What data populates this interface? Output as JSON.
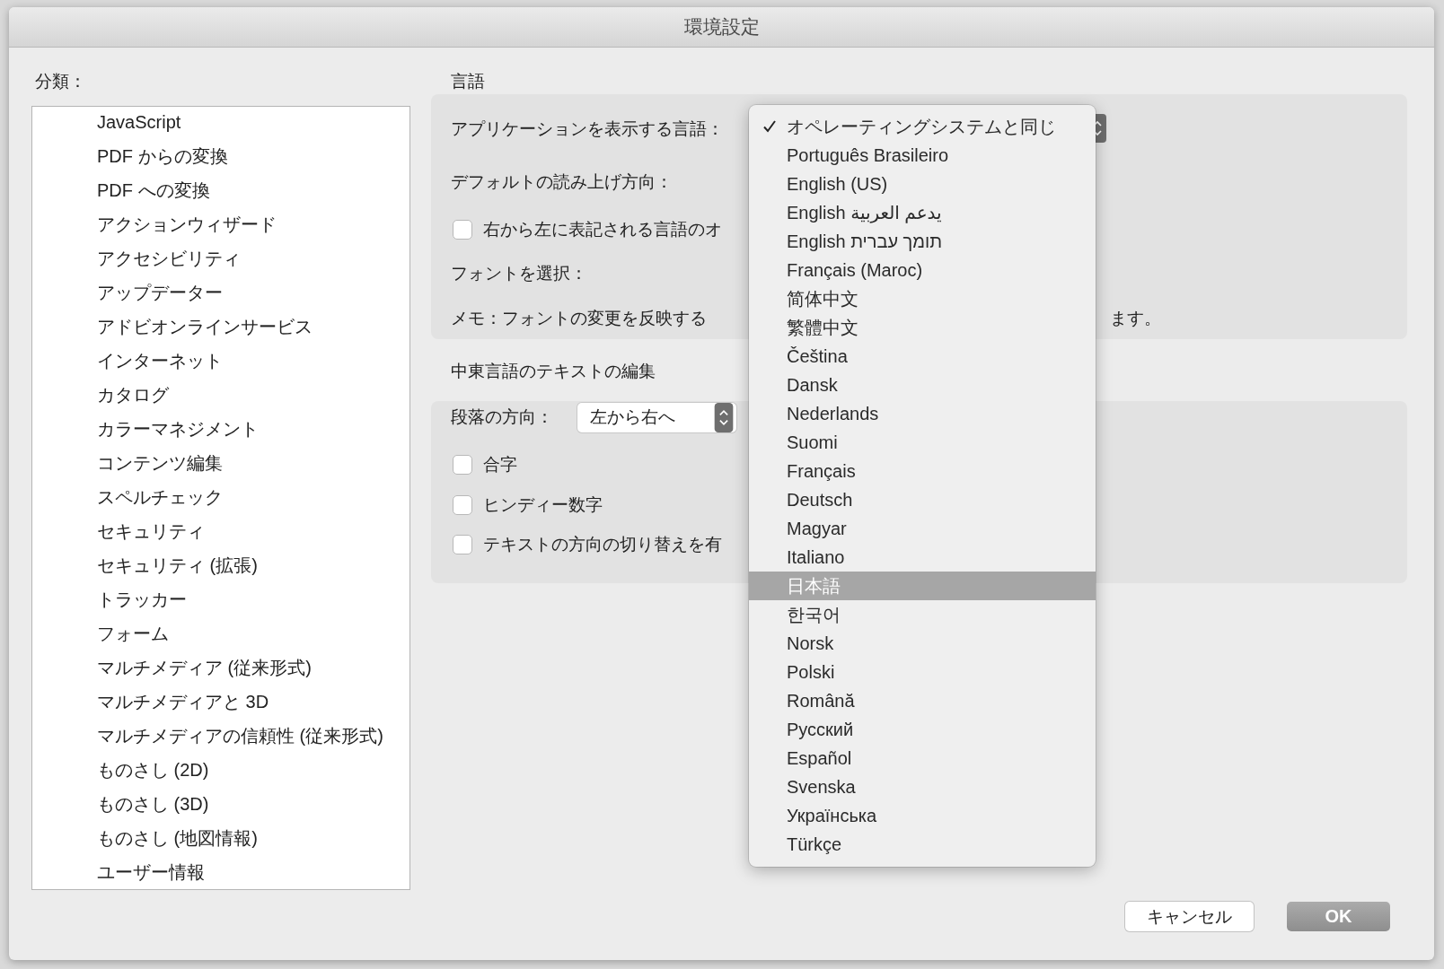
{
  "window": {
    "title": "環境設定"
  },
  "categories": {
    "label": "分類：",
    "items": [
      "JavaScript",
      "PDF からの変換",
      "PDF への変換",
      "アクションウィザード",
      "アクセシビリティ",
      "アップデーター",
      "アドビオンラインサービス",
      "インターネット",
      "カタログ",
      "カラーマネジメント",
      "コンテンツ編集",
      "スペルチェック",
      "セキュリティ",
      "セキュリティ (拡張)",
      "トラッカー",
      "フォーム",
      "マルチメディア (従来形式)",
      "マルチメディアと 3D",
      "マルチメディアの信頼性 (従来形式)",
      "ものさし (2D)",
      "ものさし (3D)",
      "ものさし (地図情報)",
      "ユーザー情報"
    ]
  },
  "language_section": {
    "title": "言語",
    "app_language": {
      "label": "アプリケーションを表示する言語："
    },
    "reading_direction": {
      "label": "デフォルトの読み上げ方向："
    },
    "rtl_option": {
      "label": "右から左に表記される言語のオ",
      "checked": false
    },
    "font": {
      "label": "フォントを選択："
    },
    "note": {
      "left": "メモ：フォントの変更を反映する",
      "right": "ます。"
    }
  },
  "middle_east_section": {
    "title": "中東言語のテキストの編集",
    "paragraph_direction": {
      "label": "段落の方向：",
      "value": "左から右へ"
    },
    "options": [
      {
        "label": "合字",
        "checked": false
      },
      {
        "label": "ヒンディー数字",
        "checked": false
      },
      {
        "label": "テキストの方向の切り替えを有",
        "checked": false
      }
    ]
  },
  "language_menu": {
    "items": [
      {
        "label": "オペレーティングシステムと同じ",
        "checked": true,
        "selected": false
      },
      {
        "label": "Português Brasileiro",
        "checked": false,
        "selected": false
      },
      {
        "label": "English (US)",
        "checked": false,
        "selected": false
      },
      {
        "label": "English يدعم العربية",
        "checked": false,
        "selected": false
      },
      {
        "label": "English תומך עברית",
        "checked": false,
        "selected": false
      },
      {
        "label": "Français (Maroc)",
        "checked": false,
        "selected": false
      },
      {
        "label": "简体中文",
        "checked": false,
        "selected": false
      },
      {
        "label": "繁體中文",
        "checked": false,
        "selected": false
      },
      {
        "label": "Čeština",
        "checked": false,
        "selected": false
      },
      {
        "label": "Dansk",
        "checked": false,
        "selected": false
      },
      {
        "label": "Nederlands",
        "checked": false,
        "selected": false
      },
      {
        "label": "Suomi",
        "checked": false,
        "selected": false
      },
      {
        "label": "Français",
        "checked": false,
        "selected": false
      },
      {
        "label": "Deutsch",
        "checked": false,
        "selected": false
      },
      {
        "label": "Magyar",
        "checked": false,
        "selected": false
      },
      {
        "label": "Italiano",
        "checked": false,
        "selected": false
      },
      {
        "label": "日本語",
        "checked": false,
        "selected": true
      },
      {
        "label": "한국어",
        "checked": false,
        "selected": false
      },
      {
        "label": "Norsk",
        "checked": false,
        "selected": false
      },
      {
        "label": "Polski",
        "checked": false,
        "selected": false
      },
      {
        "label": "Română",
        "checked": false,
        "selected": false
      },
      {
        "label": "Русский",
        "checked": false,
        "selected": false
      },
      {
        "label": "Español",
        "checked": false,
        "selected": false
      },
      {
        "label": "Svenska",
        "checked": false,
        "selected": false
      },
      {
        "label": "Українська",
        "checked": false,
        "selected": false
      },
      {
        "label": "Türkçe",
        "checked": false,
        "selected": false
      }
    ]
  },
  "buttons": [
    {
      "label": "キャンセル",
      "kind": "secondary"
    },
    {
      "label": "OK",
      "kind": "default"
    }
  ]
}
